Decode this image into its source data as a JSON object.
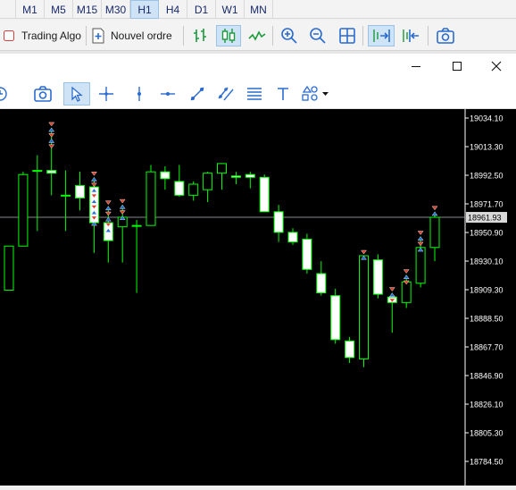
{
  "timeframes": {
    "items": [
      {
        "label": "M1",
        "active": false
      },
      {
        "label": "M5",
        "active": false
      },
      {
        "label": "M15",
        "active": false
      },
      {
        "label": "M30",
        "active": false
      },
      {
        "label": "H1",
        "active": true
      },
      {
        "label": "H4",
        "active": false
      },
      {
        "label": "D1",
        "active": false
      },
      {
        "label": "W1",
        "active": false
      },
      {
        "label": "MN",
        "active": false
      }
    ]
  },
  "toolbar": {
    "trading_algo_label": "Trading Algo",
    "new_order_label": "Nouvel ordre"
  },
  "colors": {
    "candle_bull_fill": "#000000",
    "candle_bear_fill": "#ffffff",
    "candle_outline": "#00ff00",
    "price_line": "#b0b4bf",
    "buy_arrow": "#1e6fd9",
    "sell_arrow": "#e0402a",
    "axis_text": "#ffffff",
    "background": "#000000"
  },
  "chart": {
    "current_price_label": "18961.93",
    "price_axis_labels": [
      "19034.10",
      "19013.30",
      "18992.50",
      "18971.70",
      "18950.90",
      "18930.10",
      "18909.30",
      "18888.50",
      "18867.70",
      "18846.90",
      "18826.10",
      "18805.30",
      "18784.50"
    ]
  },
  "chart_data": {
    "type": "candlestick",
    "ylim": [
      18778,
      19040
    ],
    "current_price": 18961.93,
    "candles": [
      {
        "o": 18909.0,
        "h": 18941.0,
        "l": 18909.0,
        "c": 18941.0
      },
      {
        "o": 18941.0,
        "h": 18995.0,
        "l": 18941.0,
        "c": 18993.0
      },
      {
        "o": 18996.0,
        "h": 19007.0,
        "l": 18952.0,
        "c": 18996.0
      },
      {
        "o": 18996.0,
        "h": 19027.0,
        "l": 18978.0,
        "c": 18994.0
      },
      {
        "o": 18978.0,
        "h": 18996.0,
        "l": 18952.0,
        "c": 18978.0
      },
      {
        "o": 18985.0,
        "h": 18995.0,
        "l": 18967.0,
        "c": 18976.0
      },
      {
        "o": 18984.0,
        "h": 18991.0,
        "l": 18936.0,
        "c": 18958.0
      },
      {
        "o": 18958.0,
        "h": 18970.0,
        "l": 18929.0,
        "c": 18945.0
      },
      {
        "o": 18955.0,
        "h": 18971.0,
        "l": 18929.0,
        "c": 18962.0
      },
      {
        "o": 18956.0,
        "h": 18960.0,
        "l": 18907.0,
        "c": 18956.0
      },
      {
        "o": 18956.0,
        "h": 19000.0,
        "l": 18956.0,
        "c": 18995.0
      },
      {
        "o": 18995.0,
        "h": 18999.0,
        "l": 18982.0,
        "c": 18990.0
      },
      {
        "o": 18988.0,
        "h": 19000.0,
        "l": 18977.0,
        "c": 18978.0
      },
      {
        "o": 18978.0,
        "h": 18988.0,
        "l": 18974.0,
        "c": 18986.0
      },
      {
        "o": 18982.0,
        "h": 18995.0,
        "l": 18973.0,
        "c": 18994.0
      },
      {
        "o": 18994.0,
        "h": 19001.0,
        "l": 18982.0,
        "c": 19001.0
      },
      {
        "o": 18992.0,
        "h": 18995.0,
        "l": 18986.0,
        "c": 18991.0
      },
      {
        "o": 18993.0,
        "h": 18995.0,
        "l": 18983.0,
        "c": 18991.0
      },
      {
        "o": 18991.0,
        "h": 18993.0,
        "l": 18966.0,
        "c": 18966.0
      },
      {
        "o": 18966.0,
        "h": 18971.0,
        "l": 18944.0,
        "c": 18951.0
      },
      {
        "o": 18951.0,
        "h": 18954.0,
        "l": 18942.0,
        "c": 18944.0
      },
      {
        "o": 18946.0,
        "h": 18950.0,
        "l": 18921.0,
        "c": 18924.0
      },
      {
        "o": 18921.0,
        "h": 18930.0,
        "l": 18905.0,
        "c": 18907.0
      },
      {
        "o": 18905.0,
        "h": 18910.0,
        "l": 18870.0,
        "c": 18873.0
      },
      {
        "o": 18872.0,
        "h": 18875.0,
        "l": 18856.0,
        "c": 18860.0
      },
      {
        "o": 18859.0,
        "h": 18934.0,
        "l": 18853.0,
        "c": 18934.0
      },
      {
        "o": 18931.0,
        "h": 18935.0,
        "l": 18903.0,
        "c": 18906.0
      },
      {
        "o": 18904.0,
        "h": 18907.0,
        "l": 18878.0,
        "c": 18900.0
      },
      {
        "o": 18900.0,
        "h": 18920.0,
        "l": 18896.0,
        "c": 18915.0
      },
      {
        "o": 18914.0,
        "h": 18948.0,
        "l": 18911.0,
        "c": 18940.0
      },
      {
        "o": 18940.0,
        "h": 18966.0,
        "l": 18930.0,
        "c": 18961.93
      }
    ]
  }
}
